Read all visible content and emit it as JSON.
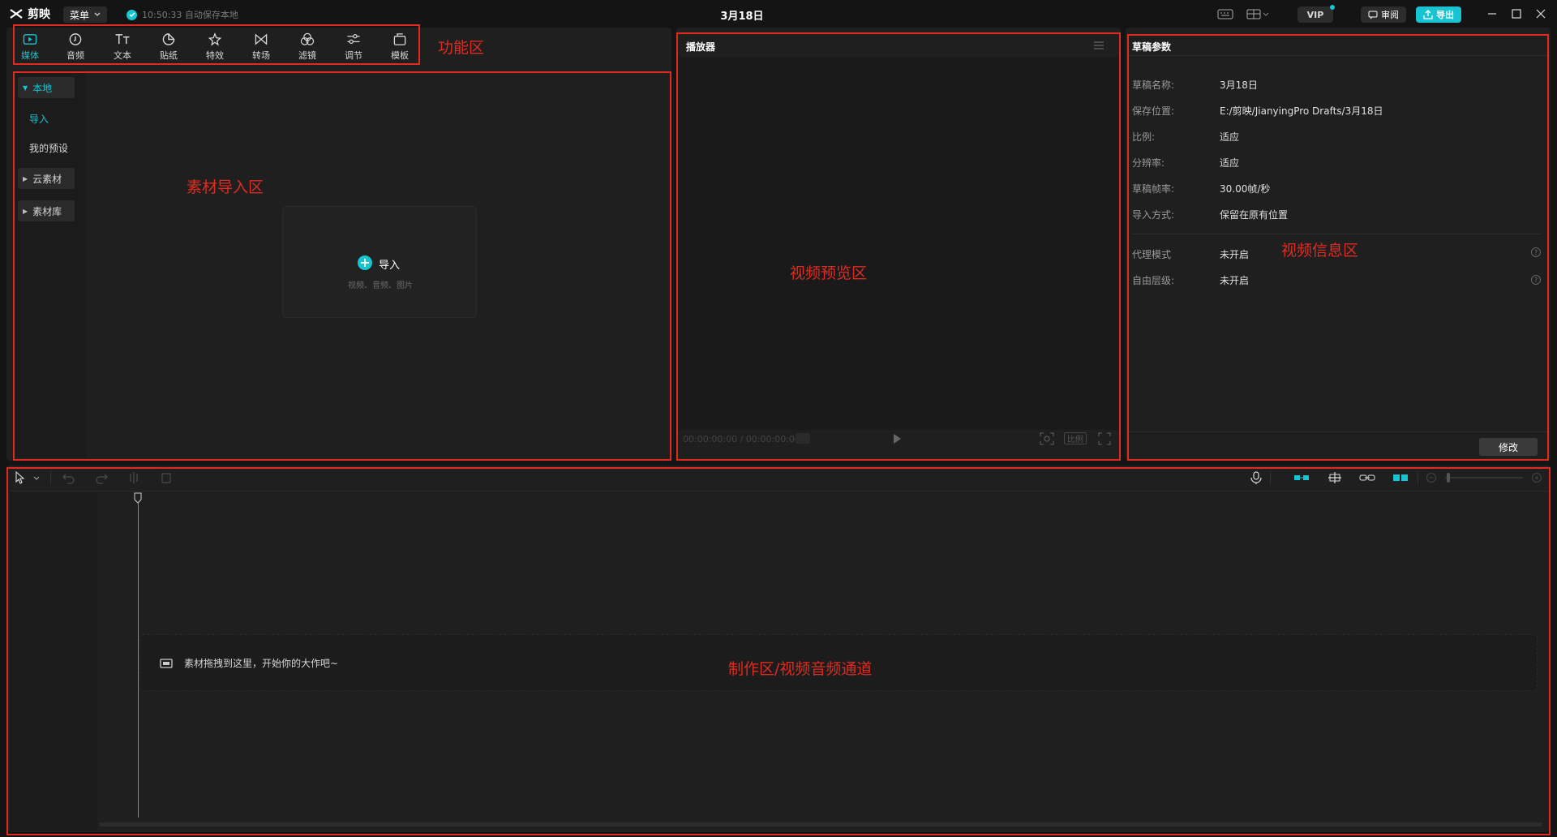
{
  "app": {
    "name": "剪映",
    "menu_label": "菜单",
    "autosave_text": "10:50:33 自动保存本地",
    "doc_title": "3月18日",
    "vip_label": "VIP",
    "review_label": "审阅",
    "export_label": "导出"
  },
  "function_tabs": [
    {
      "label": "媒体",
      "icon": "media-icon",
      "active": true
    },
    {
      "label": "音频",
      "icon": "audio-icon"
    },
    {
      "label": "文本",
      "icon": "text-icon"
    },
    {
      "label": "贴纸",
      "icon": "sticker-icon"
    },
    {
      "label": "特效",
      "icon": "effects-icon"
    },
    {
      "label": "转场",
      "icon": "transition-icon"
    },
    {
      "label": "滤镜",
      "icon": "filter-icon"
    },
    {
      "label": "调节",
      "icon": "adjust-icon"
    },
    {
      "label": "模板",
      "icon": "template-icon"
    }
  ],
  "media_sidebar": {
    "local": "本地",
    "import": "导入",
    "my_presets": "我的预设",
    "cloud": "云素材",
    "library": "素材库"
  },
  "import_card": {
    "label": "导入",
    "hint": "视频、音频、图片"
  },
  "player": {
    "title": "播放器",
    "time": "00:00:00:00 / 00:00:00:00",
    "ratio_label": "比例"
  },
  "draft_params": {
    "title": "草稿参数",
    "rows": [
      {
        "label": "草稿名称:",
        "value": "3月18日"
      },
      {
        "label": "保存位置:",
        "value": "E:/剪映/JianyingPro Drafts/3月18日"
      },
      {
        "label": "比例:",
        "value": "适应"
      },
      {
        "label": "分辨率:",
        "value": "适应"
      },
      {
        "label": "草稿帧率:",
        "value": "30.00帧/秒"
      },
      {
        "label": "导入方式:",
        "value": "保留在原有位置"
      }
    ],
    "extra_rows": [
      {
        "label": "代理模式",
        "value": "未开启"
      },
      {
        "label": "自由层级:",
        "value": "未开启"
      }
    ],
    "modify_label": "修改"
  },
  "timeline": {
    "drop_hint": "素材拖拽到这里，开始你的大作吧~"
  },
  "annotations": {
    "function_area": "功能区",
    "import_area": "素材导入区",
    "preview_area": "视频预览区",
    "info_area": "视频信息区",
    "production_area": "制作区/视频音频通道"
  },
  "colors": {
    "accent": "#19c4d2",
    "annotation": "#e12a20",
    "panel_bg": "#1f1f1f",
    "app_bg": "#141414"
  }
}
